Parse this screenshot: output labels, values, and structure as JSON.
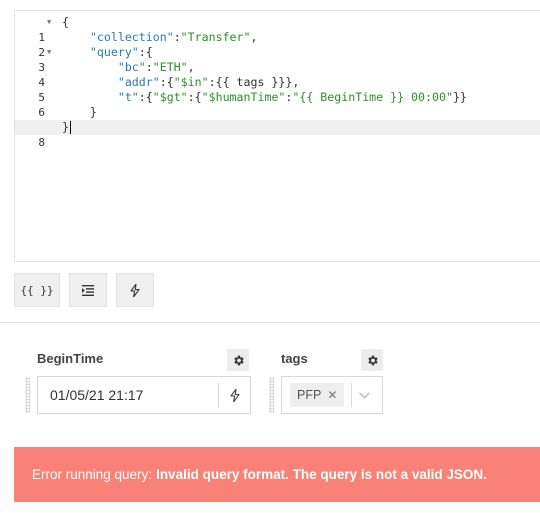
{
  "editor": {
    "lines": [
      {
        "num": "1",
        "fold": true
      },
      {
        "num": "2",
        "fold": false
      },
      {
        "num": "3",
        "fold": true
      },
      {
        "num": "4",
        "fold": false
      },
      {
        "num": "5",
        "fold": false
      },
      {
        "num": "6",
        "fold": false
      },
      {
        "num": "7",
        "fold": false
      },
      {
        "num": "8",
        "fold": false
      }
    ],
    "code": {
      "l1_open": "{",
      "l2_key": "\"collection\"",
      "l2_sep": ":",
      "l2_val": "\"Transfer\"",
      "l2_end": ",",
      "l3_key": "\"query\"",
      "l3_sep": ":{",
      "l4_key": "\"bc\"",
      "l4_sep": ":",
      "l4_val": "\"ETH\"",
      "l4_end": ",",
      "l5_key": "\"addr\"",
      "l5_sep": ":{",
      "l5_key2": "\"$in\"",
      "l5_rest": ":{{ tags }}},",
      "l6_key": "\"t\"",
      "l6_sep": ":{",
      "l6_key2": "\"$gt\"",
      "l6_sep2": ":{",
      "l6_key3": "\"$humanTime\"",
      "l6_sep3": ":",
      "l6_val": "\"{{ BeginTime }} 00:00\"",
      "l6_end": "}}",
      "l7_close": "}",
      "l8_close": "}"
    }
  },
  "toolbar": {
    "template_label": "{{ }}",
    "format_icon": "indent-icon",
    "run_icon": "bolt-icon"
  },
  "variables": {
    "begin_time": {
      "label": "BeginTime",
      "value": "01/05/21 21:17"
    },
    "tags": {
      "label": "tags",
      "chips": [
        "PFP"
      ]
    }
  },
  "error": {
    "prefix": "Error running query:",
    "message": "Invalid query format. The query is not a valid JSON."
  },
  "colors": {
    "error_bg": "#f98177",
    "json_key": "#2a7ab0",
    "json_string": "#2d8f2d"
  }
}
